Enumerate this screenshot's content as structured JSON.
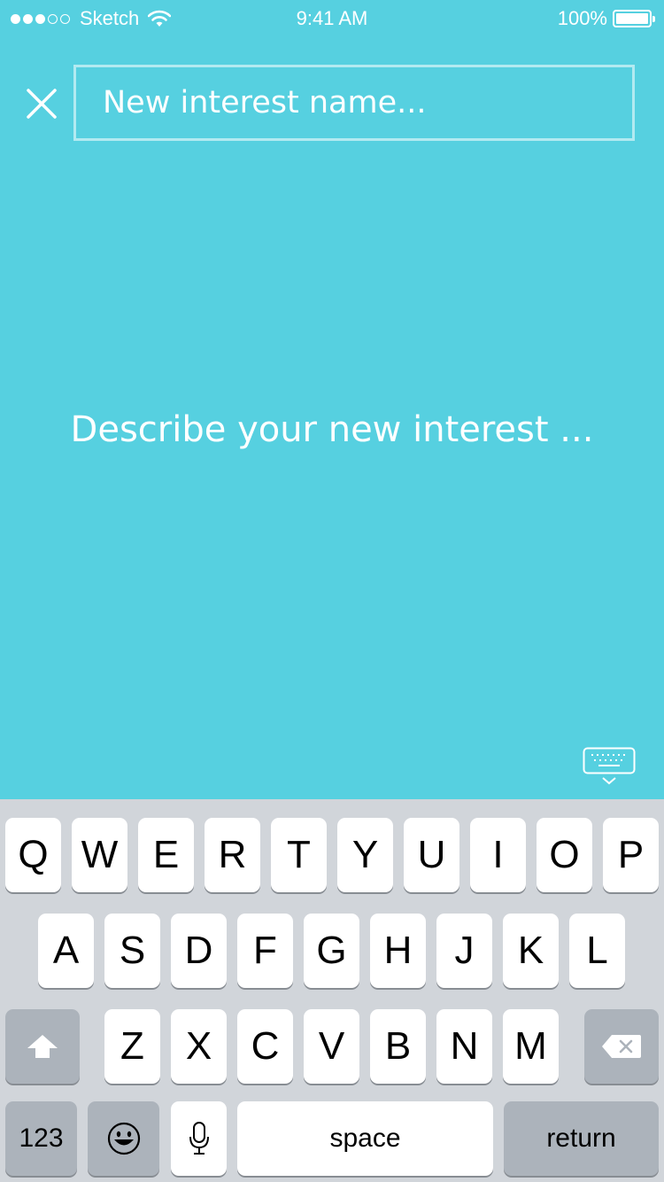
{
  "status_bar": {
    "carrier": "Sketch",
    "time": "9:41 AM",
    "battery": "100%",
    "signal_bars_filled": 3,
    "signal_bars_total": 5
  },
  "form": {
    "name_placeholder": "New interest name...",
    "description_placeholder": "Describe your new interest ..."
  },
  "keyboard": {
    "row1": [
      "Q",
      "W",
      "E",
      "R",
      "T",
      "Y",
      "U",
      "I",
      "O",
      "P"
    ],
    "row2": [
      "A",
      "S",
      "D",
      "F",
      "G",
      "H",
      "J",
      "K",
      "L"
    ],
    "row3": [
      "Z",
      "X",
      "C",
      "V",
      "B",
      "N",
      "M"
    ],
    "numbers_label": "123",
    "space_label": "space",
    "return_label": "return"
  },
  "icons": {
    "close": "close-icon",
    "wifi": "wifi-icon",
    "battery": "battery-icon",
    "dismiss_keyboard": "keyboard-dismiss-icon",
    "shift": "shift-icon",
    "delete": "delete-icon",
    "emoji": "emoji-icon",
    "microphone": "microphone-icon"
  },
  "colors": {
    "background": "#56d0e0",
    "keyboard_background": "#d1d5da",
    "key": "#ffffff",
    "function_key": "#acb3bb"
  }
}
